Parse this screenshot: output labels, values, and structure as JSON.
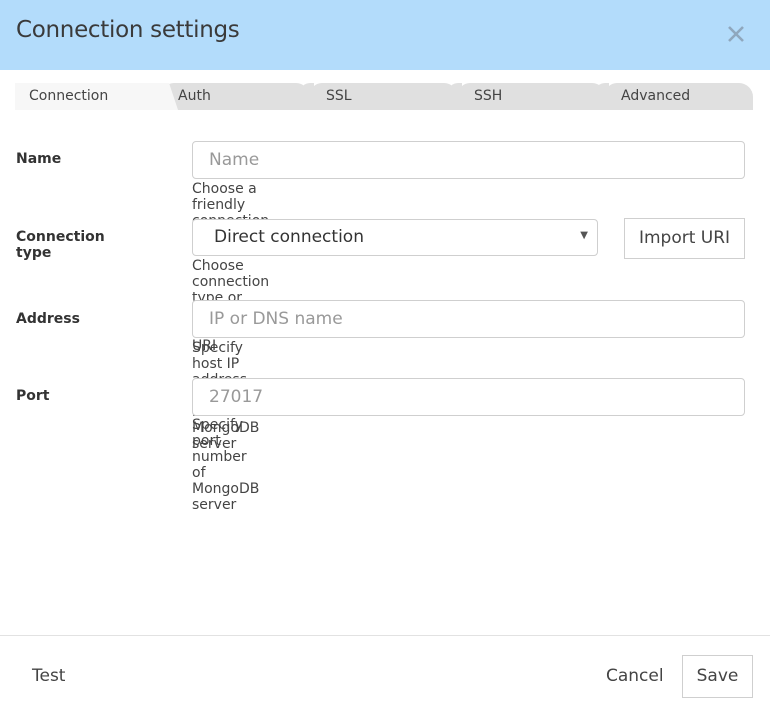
{
  "dialog": {
    "title": "Connection settings",
    "close_icon": "close-icon",
    "header_color": "#b3dcfb"
  },
  "tabs": [
    {
      "label": "Connection",
      "active": true
    },
    {
      "label": "Auth",
      "active": false
    },
    {
      "label": "SSL",
      "active": false
    },
    {
      "label": "SSH",
      "active": false
    },
    {
      "label": "Advanced",
      "active": false
    }
  ],
  "form": {
    "name": {
      "label": "Name",
      "value": "",
      "placeholder": "Name",
      "hint": "Choose a friendly connection name"
    },
    "connection_type": {
      "label": "Connection type",
      "selected": "Direct connection",
      "hint": "Choose connection type or paste from MongoDB URI",
      "import_button": "Import URI"
    },
    "address": {
      "label": "Address",
      "value": "",
      "placeholder": "IP or DNS name",
      "hint": "Specify host IP address or DNS name of MongoDB server"
    },
    "port": {
      "label": "Port",
      "value": "",
      "placeholder": "27017",
      "hint": "Specify port number of MongoDB server"
    }
  },
  "footer": {
    "test_label": "Test",
    "cancel_label": "Cancel",
    "save_label": "Save"
  }
}
